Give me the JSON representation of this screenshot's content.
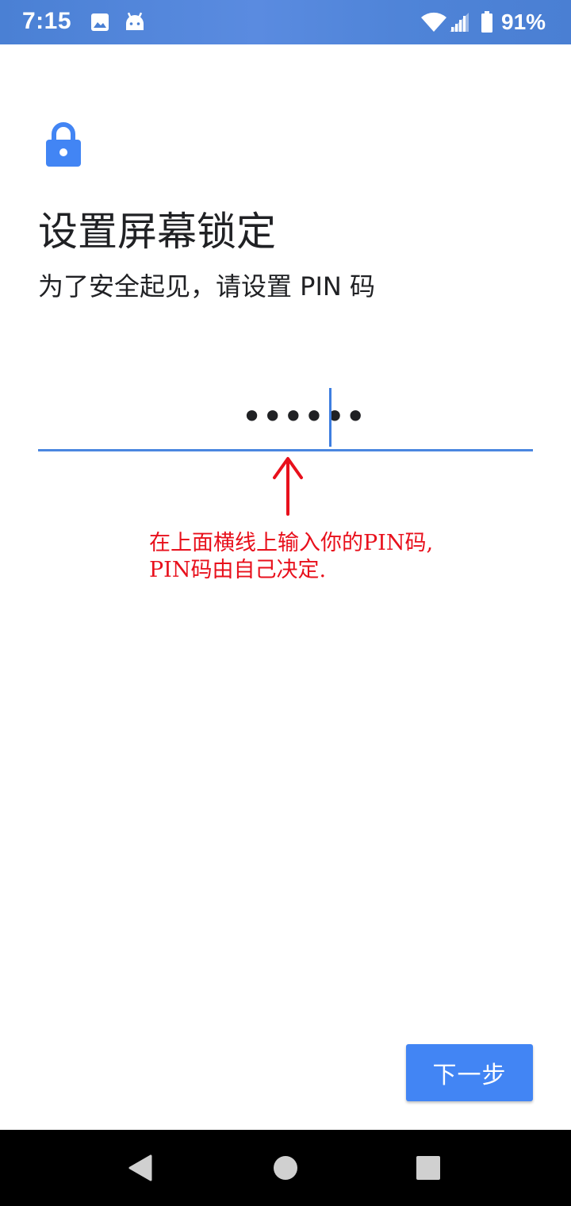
{
  "status_bar": {
    "time": "7:15",
    "battery_percent": "91%",
    "icons": [
      "image-icon",
      "android-icon",
      "wifi-icon",
      "signal-icon",
      "battery-icon"
    ],
    "background_color": "#4a80d4"
  },
  "screen": {
    "lock_icon": "lock-icon",
    "title": "设置屏幕锁定",
    "subtitle": "为了安全起见，请设置 PIN 码",
    "pin_input": {
      "masked_value": "••••••",
      "length": 6
    },
    "annotation": {
      "line1": "在上面横线上输入你的PIN码,",
      "line2": "PIN码由自己决定.",
      "color": "#e8101c"
    },
    "next_button_label": "下一步",
    "accent_color": "#4285f4"
  },
  "nav_bar": {
    "buttons": [
      "back-icon",
      "home-icon",
      "recents-icon"
    ]
  }
}
